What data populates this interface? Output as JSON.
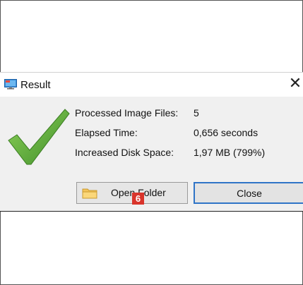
{
  "window": {
    "title": "Result",
    "close_glyph": "✕",
    "app_icon": "monitor-icon"
  },
  "info": {
    "rows": [
      {
        "label": "Processed Image Files:",
        "value": "5"
      },
      {
        "label": "Elapsed Time:",
        "value": "0,656 seconds"
      },
      {
        "label": "Increased Disk Space:",
        "value": "1,97 MB (799%)"
      }
    ]
  },
  "buttons": {
    "open_folder": "Open Folder",
    "close": "Close"
  },
  "annotation": {
    "badge": "6"
  },
  "colors": {
    "accent_border": "#2f74c7",
    "badge": "#d9342b",
    "check": "#5aa83a"
  },
  "icons": [
    "monitor-icon",
    "close-icon",
    "checkmark-icon",
    "folder-icon"
  ]
}
